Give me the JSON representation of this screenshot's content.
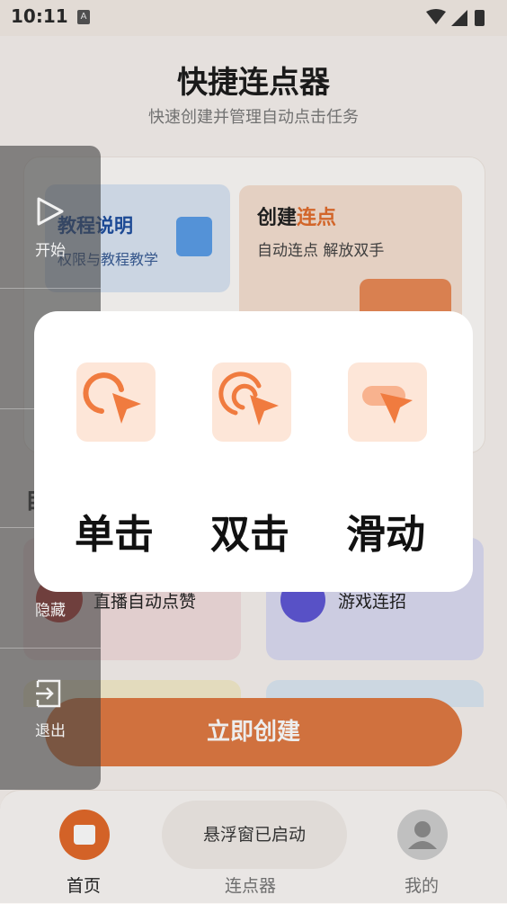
{
  "status": {
    "time": "10:11",
    "notif_icon": "a-icon"
  },
  "header": {
    "title": "快捷连点器",
    "subtitle": "快速创建并管理自动点击任务"
  },
  "cards": {
    "tutorial": {
      "title": "教程说明",
      "subtitle": "权限与教程教学"
    },
    "create": {
      "title_a": "创建",
      "title_b": "连点",
      "subtitle": "自动连点 解放双手"
    },
    "peek": "自",
    "live": {
      "label": "直播自动点赞"
    },
    "game": {
      "label": "游戏连招"
    }
  },
  "create_button": "立即创建",
  "side_menu": {
    "items": [
      {
        "label": "开始",
        "icon": "play-icon"
      },
      {
        "label": "隐藏",
        "icon": "eye-off-icon"
      },
      {
        "label": "退出",
        "icon": "exit-icon"
      }
    ]
  },
  "dialog": {
    "options": [
      {
        "label": "单击"
      },
      {
        "label": "双击"
      },
      {
        "label": "滑动"
      }
    ]
  },
  "toast": "悬浮窗已启动",
  "nav": {
    "home": "首页",
    "clicker": "连点器",
    "me": "我的"
  },
  "colors": {
    "accent": "#e26d2d",
    "icon_bg": "#fde6d8"
  }
}
